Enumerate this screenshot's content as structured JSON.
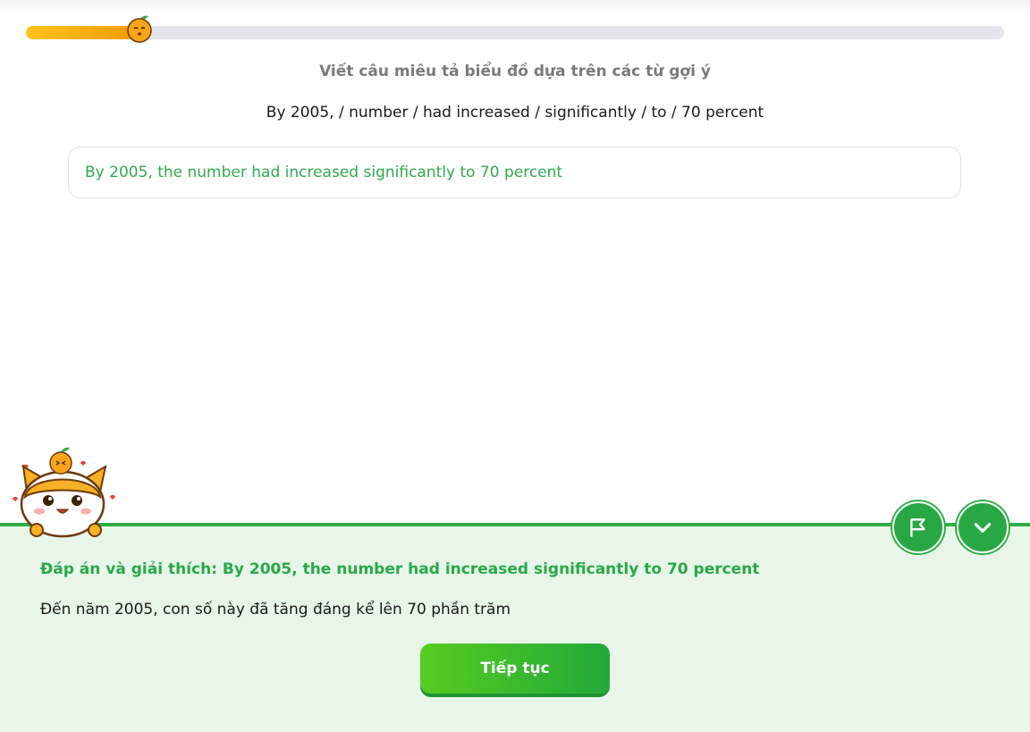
{
  "progress": {
    "value": 0.115,
    "mascot_icon": "orange-mascot-icon"
  },
  "prompt": {
    "instruction": "Viết câu miêu tả biểu đồ dựa trên các từ gợi ý",
    "hint_words": "By 2005, / number / had increased / significantly / to / 70 percent"
  },
  "answer": {
    "value": "By 2005, the number had increased significantly to 70 percent"
  },
  "feedback": {
    "title": "Đáp án và giải thích: By 2005, the number had increased significantly to 70 percent",
    "translation": "Đến năm 2005, con số này đã tăng đáng kể lên 70 phần trăm",
    "continue_label": "Tiếp tục",
    "report_icon": "flag-icon",
    "collapse_icon": "chevron-down-icon",
    "mascot": "cat-mascot-with-orange",
    "colors": {
      "accent": "#2aa84a",
      "sheet_bg": "#e8f6e8",
      "progress": "#f5a300"
    }
  }
}
